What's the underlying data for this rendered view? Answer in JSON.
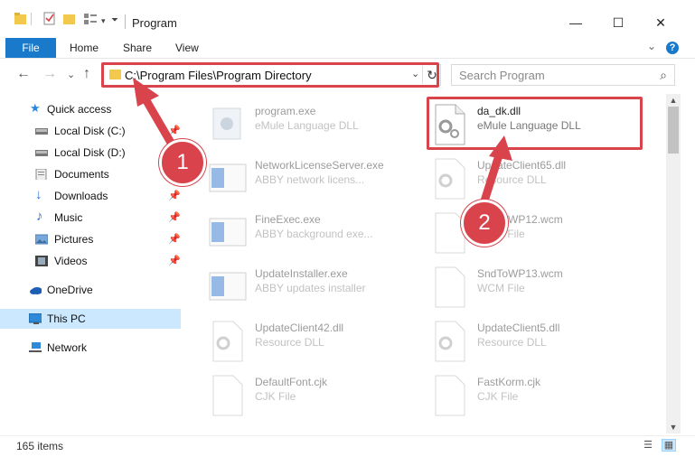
{
  "window": {
    "title": "Program",
    "minimize": "—",
    "maximize": "☐",
    "close": "✕"
  },
  "ribbon": {
    "file": "File",
    "home": "Home",
    "share": "Share",
    "view": "View",
    "help": "?"
  },
  "nav": {
    "back": "←",
    "forward": "→",
    "up": "↑",
    "recent": "⌄"
  },
  "address": {
    "path": "C:\\Program Files\\Program Directory",
    "dropdown": "⌄",
    "refresh": "↻"
  },
  "search": {
    "placeholder": "Search Program",
    "icon": "⌕"
  },
  "sidebar": {
    "items": [
      {
        "label": "Quick access",
        "icon": "star-icon",
        "pinned": false
      },
      {
        "label": "Local Disk (C:)",
        "icon": "drive-icon",
        "pinned": true
      },
      {
        "label": "Local Disk (D:)",
        "icon": "drive-icon",
        "pinned": false
      },
      {
        "label": "Documents",
        "icon": "documents-icon",
        "pinned": true
      },
      {
        "label": "Downloads",
        "icon": "downloads-icon",
        "pinned": true
      },
      {
        "label": "Music",
        "icon": "music-icon",
        "pinned": true
      },
      {
        "label": "Pictures",
        "icon": "pictures-icon",
        "pinned": true
      },
      {
        "label": "Videos",
        "icon": "videos-icon",
        "pinned": true
      },
      {
        "label": "OneDrive",
        "icon": "onedrive-icon",
        "pinned": false
      },
      {
        "label": "This PC",
        "icon": "pc-icon",
        "pinned": false,
        "selected": true
      },
      {
        "label": "Network",
        "icon": "network-icon",
        "pinned": false
      }
    ],
    "pin_glyph": "📌"
  },
  "files": [
    {
      "name": "program.exe",
      "type": "eMule Language DLL",
      "kind": "exe"
    },
    {
      "name": "da_dk.dll",
      "type": "eMule Language DLL",
      "kind": "dll",
      "highlighted": true
    },
    {
      "name": "NetworkLicenseServer.exe",
      "type": "ABBY network licens...",
      "kind": "app"
    },
    {
      "name": "UpdateClient65.dll",
      "type": "Resource DLL",
      "kind": "dll"
    },
    {
      "name": "FineExec.exe",
      "type": "ABBY background exe...",
      "kind": "app"
    },
    {
      "name": "SndToWP12.wcm",
      "type": "WCM File",
      "kind": "doc"
    },
    {
      "name": "UpdateInstaller.exe",
      "type": "ABBY updates installer",
      "kind": "app"
    },
    {
      "name": "SndToWP13.wcm",
      "type": "WCM File",
      "kind": "doc"
    },
    {
      "name": "UpdateClient42.dll",
      "type": "Resource DLL",
      "kind": "dll"
    },
    {
      "name": "UpdateClient5.dll",
      "type": "Resource DLL",
      "kind": "dll"
    },
    {
      "name": "DefaultFont.cjk",
      "type": "CJK File",
      "kind": "doc"
    },
    {
      "name": "FastKorm.cjk",
      "type": "CJK File",
      "kind": "doc"
    }
  ],
  "annotations": {
    "step1": "1",
    "step2": "2"
  },
  "status": {
    "count": "165 items"
  },
  "colors": {
    "accent": "#1979ca",
    "highlight": "#d9434b",
    "selection": "#cce8ff"
  }
}
